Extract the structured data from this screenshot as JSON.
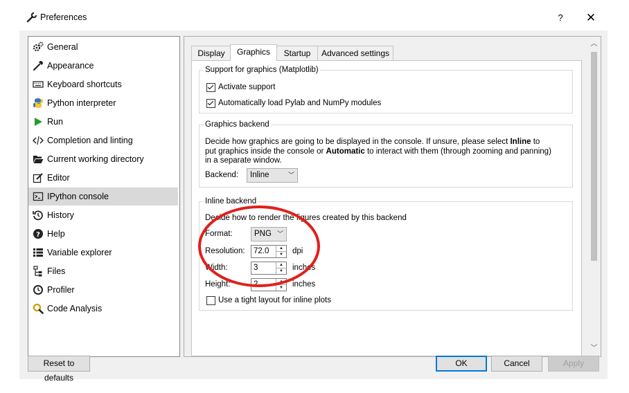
{
  "window": {
    "title": "Preferences",
    "help_glyph": "?",
    "close_glyph": "✕"
  },
  "sidebar": {
    "items": [
      {
        "label": "General",
        "icon": "gears-icon"
      },
      {
        "label": "Appearance",
        "icon": "eyedropper-icon"
      },
      {
        "label": "Keyboard shortcuts",
        "icon": "keyboard-icon"
      },
      {
        "label": "Python interpreter",
        "icon": "python-icon"
      },
      {
        "label": "Run",
        "icon": "play-icon"
      },
      {
        "label": "Completion and linting",
        "icon": "code-icon"
      },
      {
        "label": "Current working directory",
        "icon": "folder-open-icon"
      },
      {
        "label": "Editor",
        "icon": "edit-icon"
      },
      {
        "label": "IPython console",
        "icon": "terminal-icon",
        "selected": true
      },
      {
        "label": "History",
        "icon": "history-icon"
      },
      {
        "label": "Help",
        "icon": "question-circle-icon"
      },
      {
        "label": "Variable explorer",
        "icon": "list-icon"
      },
      {
        "label": "Files",
        "icon": "file-tree-icon"
      },
      {
        "label": "Profiler",
        "icon": "clock-icon"
      },
      {
        "label": "Code Analysis",
        "icon": "magnifier-icon"
      }
    ]
  },
  "tabs": [
    {
      "label": "Display",
      "active": false
    },
    {
      "label": "Graphics",
      "active": true
    },
    {
      "label": "Startup",
      "active": false
    },
    {
      "label": "Advanced settings",
      "active": false
    }
  ],
  "support_group": {
    "title": "Support for graphics (Matplotlib)",
    "activate_label": "Activate support",
    "activate_checked": true,
    "autoload_label": "Automatically load Pylab and NumPy modules",
    "autoload_checked": true
  },
  "backend_group": {
    "title": "Graphics backend",
    "desc_part1": "Decide how graphics are going to be displayed in the console. If unsure, please select ",
    "desc_bold1": "Inline",
    "desc_part2": " to put graphics inside the console or ",
    "desc_bold2": "Automatic",
    "desc_part3": " to interact with them (through zooming and panning) in a separate window.",
    "backend_label": "Backend:",
    "backend_value": "Inline"
  },
  "inline_group": {
    "title": "Inline backend",
    "desc": "Decide how to render the figures created by this backend",
    "format_label": "Format:",
    "format_value": "PNG",
    "resolution_label": "Resolution:",
    "resolution_value": "72.0",
    "resolution_unit": "dpi",
    "width_label": "Width:",
    "width_value": "3",
    "width_unit": "inches",
    "height_label": "Height:",
    "height_value": "2",
    "height_unit": "inches",
    "tight_label": "Use a tight layout for inline plots",
    "tight_checked": false
  },
  "buttons": {
    "reset": "Reset to defaults",
    "ok": "OK",
    "cancel": "Cancel",
    "apply": "Apply"
  },
  "glyphs": {
    "up": "▲",
    "down": "▼",
    "scroll_up": "︿",
    "scroll_down": "﹀",
    "combo_arrow": "﹀"
  },
  "colors": {
    "accent": "#0078d7",
    "annotation": "#e0201b",
    "selected_bg": "#d9d9d9"
  }
}
